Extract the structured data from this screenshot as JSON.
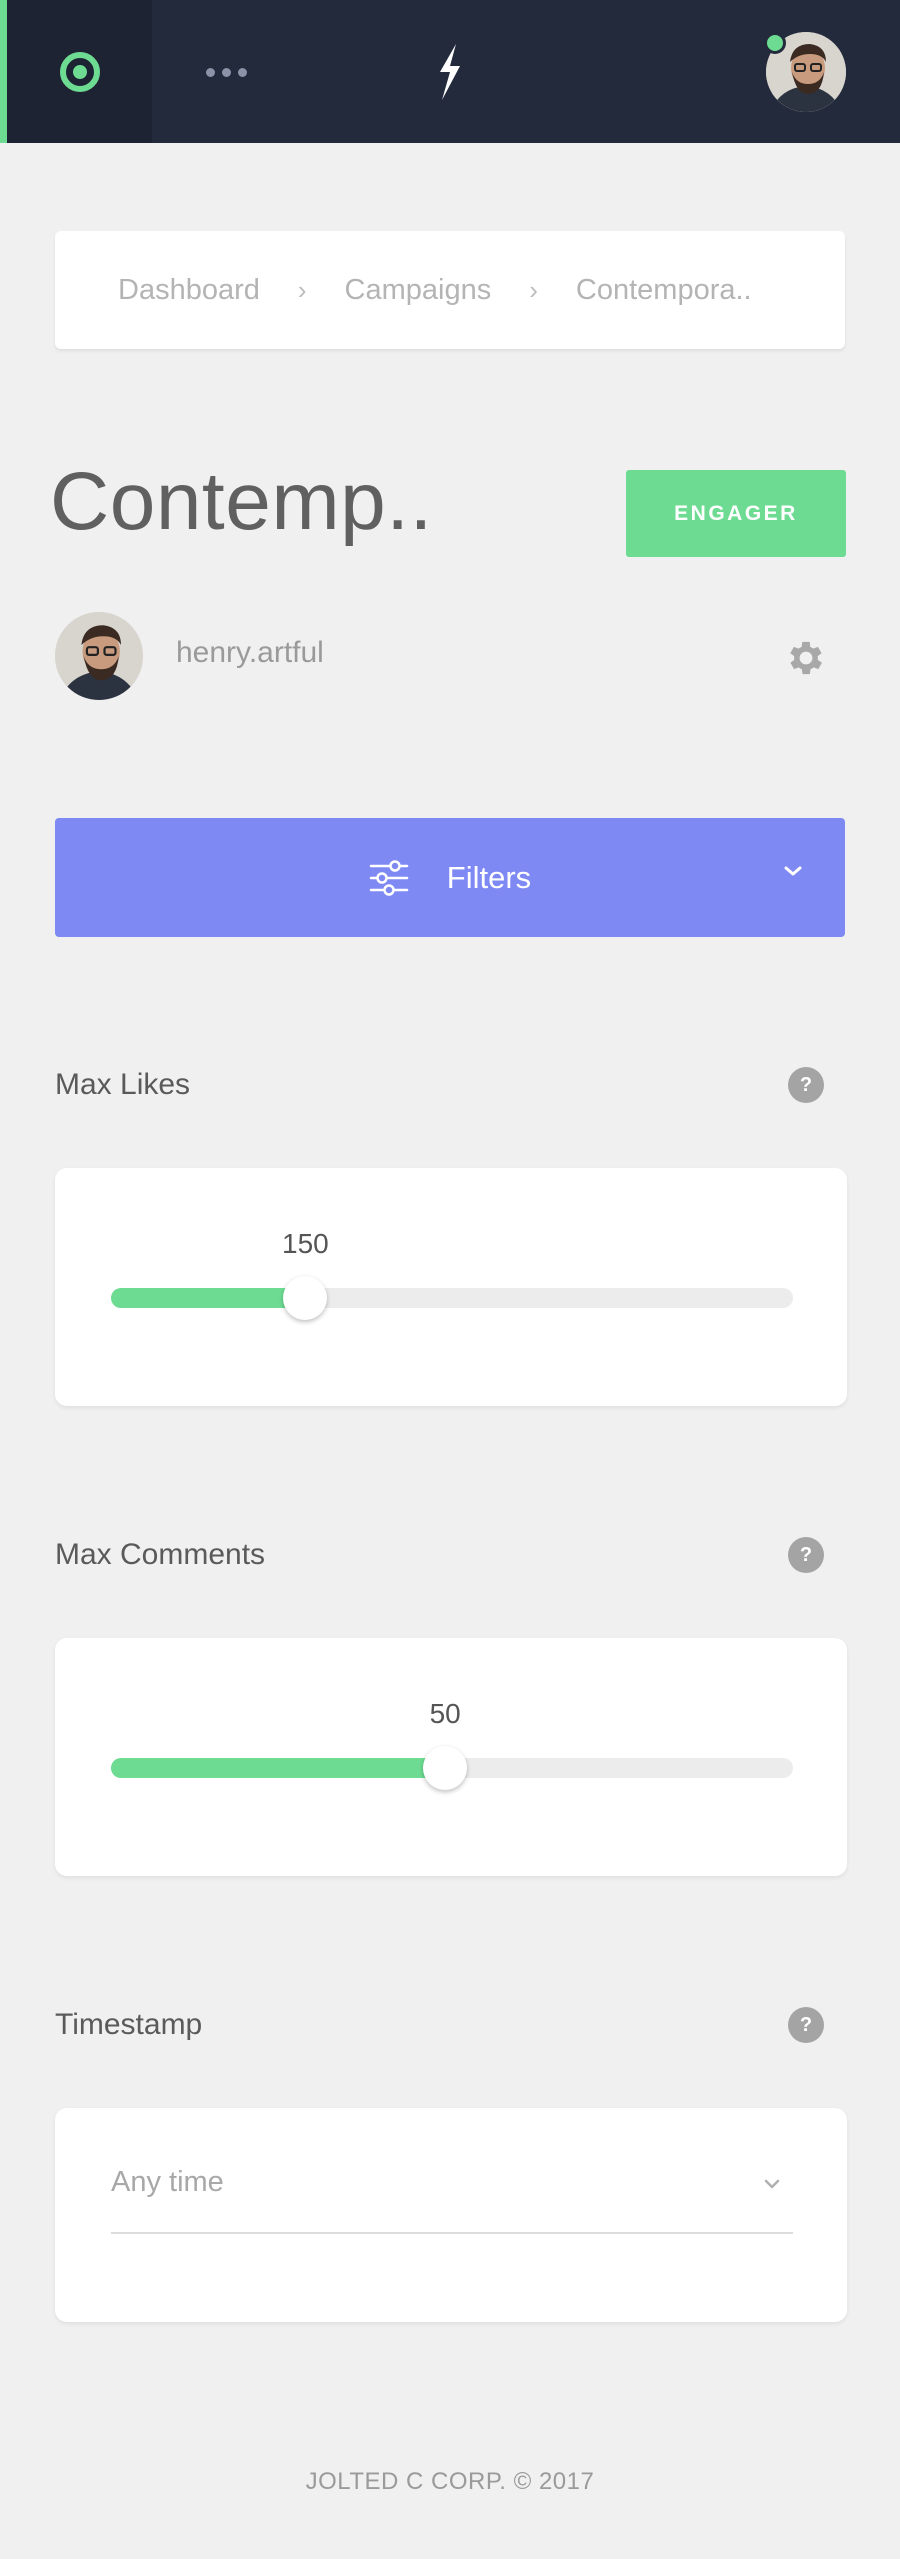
{
  "topbar": {
    "home_icon": "target-icon",
    "more_icon": "more-dots-icon",
    "logo_icon": "lightning-bolt-icon",
    "avatar_alt": "user avatar",
    "online": true
  },
  "breadcrumb": {
    "items": [
      "Dashboard",
      "Campaigns",
      "Contempora.."
    ],
    "separator": "›"
  },
  "page": {
    "title": "Contemp..",
    "engager_label": "ENGAGER"
  },
  "user": {
    "username": "henry.artful"
  },
  "filters": {
    "label": "Filters"
  },
  "max_likes": {
    "label": "Max Likes",
    "help": "?",
    "value": "150",
    "fraction": 0.285
  },
  "max_comments": {
    "label": "Max Comments",
    "help": "?",
    "value": "50",
    "fraction": 0.49
  },
  "timestamp": {
    "label": "Timestamp",
    "help": "?",
    "selected": "Any time"
  },
  "footer": {
    "text": "JOLTED C CORP. © 2017"
  },
  "colors": {
    "topbar": "#232a3c",
    "accent_green": "#6ddc92",
    "filters_purple": "#7e89f3",
    "background": "#f0f0f0"
  }
}
